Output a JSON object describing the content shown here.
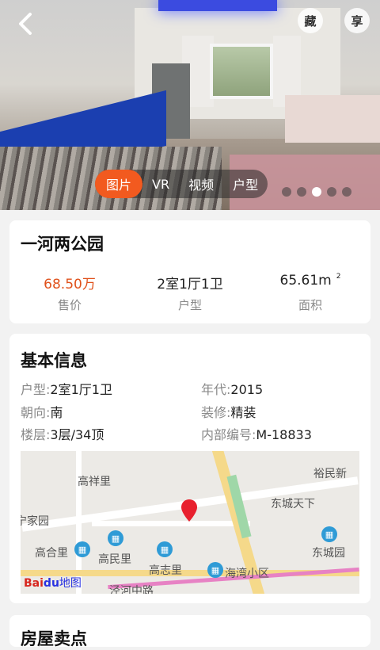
{
  "hero": {
    "back_icon": "chevron-left-icon",
    "fav_label": "藏",
    "share_label": "享",
    "media_tabs": [
      "图片",
      "VR",
      "视频",
      "户型"
    ],
    "active_tab": "图片",
    "slide_count": 5,
    "active_slide": 1,
    "accent": "#f25a1f"
  },
  "summary": {
    "title": "一河两公园",
    "price_value": "68.50万",
    "price_label": "售价",
    "layout_value": "2室1厅1卫",
    "layout_label": "户型",
    "area_value": "65.61m",
    "area_unit": "2",
    "area_label": "面积"
  },
  "basic": {
    "title": "基本信息",
    "layout_key": "户型:",
    "layout_val": "2室1厅1卫",
    "year_key": "年代:",
    "year_val": "2015",
    "orient_key": "朝向:",
    "orient_val": "南",
    "decor_key": "装修:",
    "decor_val": "精装",
    "floor_key": "楼层:",
    "floor_val": "3层/34顶",
    "code_key": "内部编号:",
    "code_val": "M-18833"
  },
  "map": {
    "labels": [
      "高祥里",
      "裕民新",
      "东城天下",
      "宁家园",
      "高合里",
      "高民里",
      "高志里",
      "海湾小区",
      "东城园",
      "泾河中路"
    ],
    "logo_text": "Bai",
    "logo_paw": "du",
    "logo_cn": "地图"
  },
  "next": {
    "title": "房屋卖点"
  }
}
